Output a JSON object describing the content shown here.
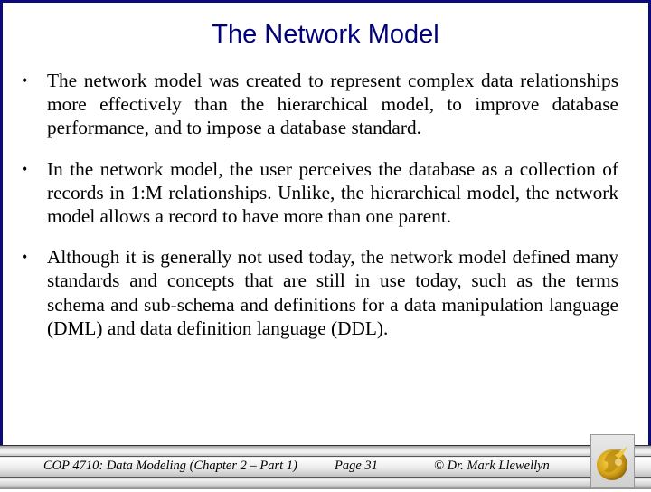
{
  "slide": {
    "title": "The Network Model",
    "bullets": [
      "The network model was created to represent complex data relationships more effectively than the hierarchical model, to improve database performance, and to impose a database standard.",
      "In the network model, the user perceives the database as a collection of records in 1:M relationships.  Unlike, the hierarchical model, the network model allows a record to have more than one parent.",
      "Although it is generally not used today, the network model defined many standards and concepts that are still in use today, such as the terms schema and sub-schema and definitions for a data manipulation language (DML) and data definition language (DDL)."
    ],
    "bullet_glyph": "•"
  },
  "footer": {
    "course": "COP 4710: Data Modeling (Chapter 2 – Part 1)",
    "page": "Page 31",
    "author": "© Dr. Mark Llewellyn",
    "logo": "ucf-pegasus-logo"
  },
  "colors": {
    "title": "#00007a",
    "frame_border": "#0a0a7a",
    "logo_gold": "#d4a017"
  }
}
